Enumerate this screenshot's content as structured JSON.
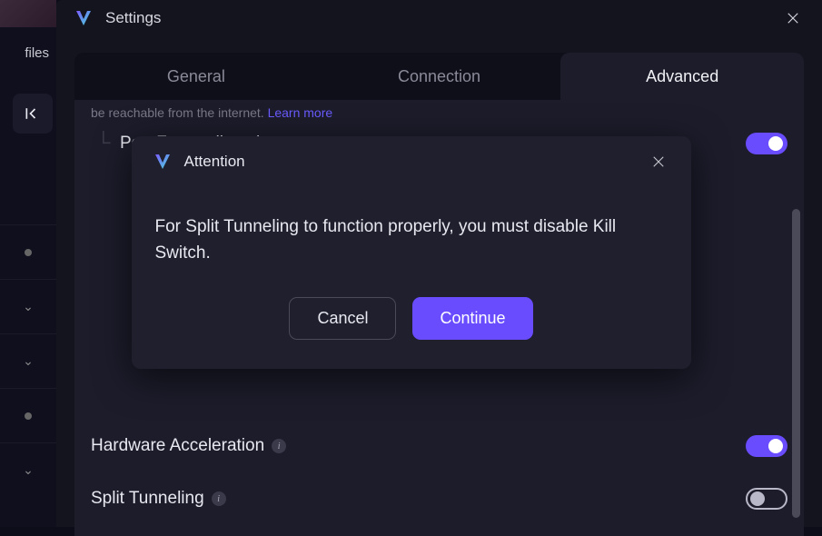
{
  "sidebar": {
    "profiles_fragment": "files"
  },
  "settings": {
    "title": "Settings",
    "tabs": {
      "general": "General",
      "connection": "Connection",
      "advanced": "Advanced"
    },
    "desc_fragment": "be reachable from the internet.",
    "learn_more": "Learn more",
    "rows": {
      "port_forward_shortcut": "Port Forwarding shortcut",
      "hardware_accel": "Hardware Acceleration",
      "split_tunneling": "Split Tunneling"
    },
    "toggles": {
      "port_forward_shortcut": true,
      "hardware_accel": true,
      "split_tunneling": false
    }
  },
  "modal": {
    "title": "Attention",
    "message": "For Split Tunneling to function properly, you must disable Kill Switch.",
    "cancel": "Cancel",
    "continue": "Continue"
  }
}
